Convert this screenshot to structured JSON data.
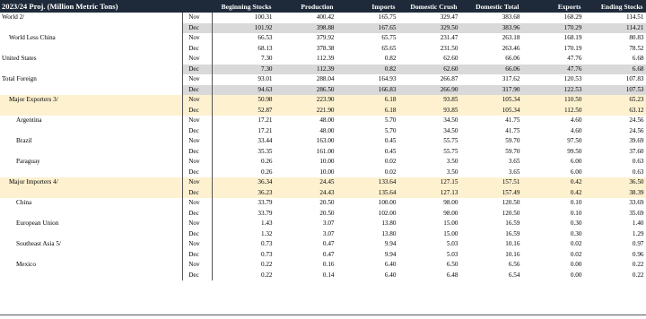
{
  "header": {
    "title": "2023/24 Proj. (Million Metric Tons)",
    "columns": [
      "Beginning Stocks",
      "Production",
      "Imports",
      "Domestic Crush",
      "Domestic Total",
      "Exports",
      "Ending Stocks"
    ]
  },
  "rows": [
    {
      "name": "World  2/",
      "period": "Nov",
      "values": [
        "100.31",
        "400.42",
        "165.75",
        "329.47",
        "383.68",
        "168.29",
        "114.51"
      ],
      "indent": 0,
      "shade": ""
    },
    {
      "name": "",
      "period": "Dec",
      "values": [
        "101.92",
        "398.88",
        "167.65",
        "329.50",
        "383.96",
        "170.29",
        "114.21"
      ],
      "indent": 0,
      "shade": "gray"
    },
    {
      "name": "World Less China",
      "period": "Nov",
      "values": [
        "66.53",
        "379.92",
        "65.75",
        "231.47",
        "263.18",
        "168.19",
        "80.83"
      ],
      "indent": 1,
      "shade": ""
    },
    {
      "name": "",
      "period": "Dec",
      "values": [
        "68.13",
        "378.38",
        "65.65",
        "231.50",
        "263.46",
        "170.19",
        "78.52"
      ],
      "indent": 0,
      "shade": ""
    },
    {
      "name": "United States",
      "period": "Nov",
      "values": [
        "7.30",
        "112.39",
        "0.82",
        "62.60",
        "66.06",
        "47.76",
        "6.68"
      ],
      "indent": 0,
      "shade": ""
    },
    {
      "name": "",
      "period": "Dec",
      "values": [
        "7.30",
        "112.39",
        "0.82",
        "62.60",
        "66.06",
        "47.76",
        "6.68"
      ],
      "indent": 0,
      "shade": "gray"
    },
    {
      "name": "Total Foreign",
      "period": "Nov",
      "values": [
        "93.01",
        "288.04",
        "164.93",
        "266.87",
        "317.62",
        "120.53",
        "107.83"
      ],
      "indent": 0,
      "shade": ""
    },
    {
      "name": "",
      "period": "Dec",
      "values": [
        "94.63",
        "286.50",
        "166.83",
        "266.90",
        "317.90",
        "122.53",
        "107.53"
      ],
      "indent": 0,
      "shade": "gray"
    },
    {
      "name": "Major Exporters  3/",
      "period": "Nov",
      "values": [
        "50.98",
        "223.90",
        "6.18",
        "93.85",
        "105.34",
        "110.50",
        "65.23"
      ],
      "indent": 1,
      "shade": "yellow"
    },
    {
      "name": "",
      "period": "Dec",
      "values": [
        "52.87",
        "221.90",
        "6.18",
        "93.85",
        "105.34",
        "112.50",
        "63.12"
      ],
      "indent": 0,
      "shade": "yellow"
    },
    {
      "name": "Argentina",
      "period": "Nov",
      "values": [
        "17.21",
        "48.00",
        "5.70",
        "34.50",
        "41.75",
        "4.60",
        "24.56"
      ],
      "indent": 2,
      "shade": ""
    },
    {
      "name": "",
      "period": "Dec",
      "values": [
        "17.21",
        "48.00",
        "5.70",
        "34.50",
        "41.75",
        "4.60",
        "24.56"
      ],
      "indent": 0,
      "shade": ""
    },
    {
      "name": "Brazil",
      "period": "Nov",
      "values": [
        "33.44",
        "163.00",
        "0.45",
        "55.75",
        "59.70",
        "97.50",
        "39.69"
      ],
      "indent": 2,
      "shade": ""
    },
    {
      "name": "",
      "period": "Dec",
      "values": [
        "35.35",
        "161.00",
        "0.45",
        "55.75",
        "59.70",
        "99.50",
        "37.60"
      ],
      "indent": 0,
      "shade": ""
    },
    {
      "name": "Paraguay",
      "period": "Nov",
      "values": [
        "0.26",
        "10.00",
        "0.02",
        "3.50",
        "3.65",
        "6.00",
        "0.63"
      ],
      "indent": 2,
      "shade": ""
    },
    {
      "name": "",
      "period": "Dec",
      "values": [
        "0.26",
        "10.00",
        "0.02",
        "3.50",
        "3.65",
        "6.00",
        "0.63"
      ],
      "indent": 0,
      "shade": ""
    },
    {
      "name": "Major Importers  4/",
      "period": "Nov",
      "values": [
        "36.34",
        "24.45",
        "133.64",
        "127.15",
        "157.51",
        "0.42",
        "36.50"
      ],
      "indent": 1,
      "shade": "yellow"
    },
    {
      "name": "",
      "period": "Dec",
      "values": [
        "36.23",
        "24.43",
        "135.64",
        "127.13",
        "157.49",
        "0.42",
        "38.39"
      ],
      "indent": 0,
      "shade": "yellow"
    },
    {
      "name": "China",
      "period": "Nov",
      "values": [
        "33.79",
        "20.50",
        "100.00",
        "98.00",
        "120.50",
        "0.10",
        "33.69"
      ],
      "indent": 2,
      "shade": ""
    },
    {
      "name": "",
      "period": "Dec",
      "values": [
        "33.79",
        "20.50",
        "102.00",
        "98.00",
        "120.50",
        "0.10",
        "35.69"
      ],
      "indent": 0,
      "shade": ""
    },
    {
      "name": "European Union",
      "period": "Nov",
      "values": [
        "1.43",
        "3.07",
        "13.80",
        "15.00",
        "16.59",
        "0.30",
        "1.40"
      ],
      "indent": 2,
      "shade": ""
    },
    {
      "name": "",
      "period": "Dec",
      "values": [
        "1.32",
        "3.07",
        "13.80",
        "15.00",
        "16.59",
        "0.30",
        "1.29"
      ],
      "indent": 0,
      "shade": ""
    },
    {
      "name": "Southeast Asia 5/",
      "period": "Nov",
      "values": [
        "0.73",
        "0.47",
        "9.94",
        "5.03",
        "10.16",
        "0.02",
        "0.97"
      ],
      "indent": 2,
      "shade": ""
    },
    {
      "name": "",
      "period": "Dec",
      "values": [
        "0.73",
        "0.47",
        "9.94",
        "5.03",
        "10.16",
        "0.02",
        "0.96"
      ],
      "indent": 0,
      "shade": ""
    },
    {
      "name": "Mexico",
      "period": "Nov",
      "values": [
        "0.22",
        "0.16",
        "6.40",
        "6.50",
        "6.56",
        "0.00",
        "0.22"
      ],
      "indent": 2,
      "shade": ""
    },
    {
      "name": "",
      "period": "Dec",
      "values": [
        "0.22",
        "0.14",
        "6.40",
        "6.48",
        "6.54",
        "0.00",
        "0.22"
      ],
      "indent": 0,
      "shade": ""
    }
  ]
}
